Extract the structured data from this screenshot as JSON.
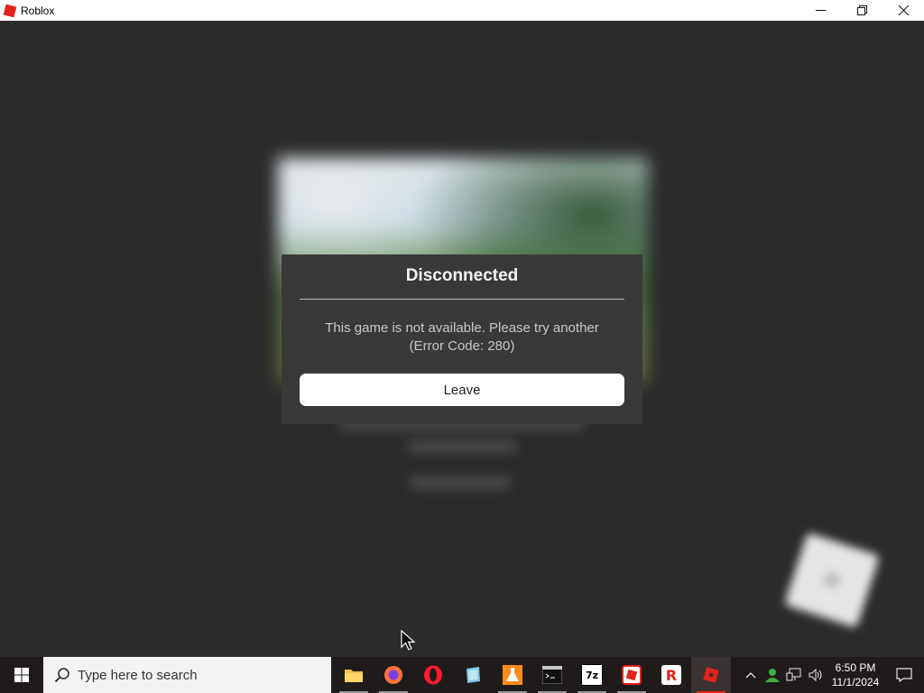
{
  "window": {
    "title": "Roblox",
    "controls": {
      "minimize_icon": "─",
      "restore_icon": "❐",
      "close_icon": "✕"
    }
  },
  "dialog": {
    "heading": "Disconnected",
    "message_line1": "This game is not available. Please try another",
    "message_line2": "(Error Code: 280)",
    "leave_label": "Leave"
  },
  "taskbar": {
    "search_placeholder": "Type here to search",
    "apps": [
      {
        "name": "file-explorer",
        "color": "#f2c14e"
      },
      {
        "name": "firefox",
        "color": "#ff7139"
      },
      {
        "name": "opera",
        "color": "#ff1b2d"
      },
      {
        "name": "notepad",
        "color": "#7fc6e8"
      },
      {
        "name": "lab-flask",
        "color": "#ff8c1a"
      },
      {
        "name": "terminal",
        "color": "#111111"
      },
      {
        "name": "7zip",
        "label": "7z",
        "color": "#ffffff"
      },
      {
        "name": "roblox-studio",
        "color": "#e2231a"
      },
      {
        "name": "roblox-player",
        "label": "R",
        "color": "#e2231a"
      },
      {
        "name": "roblox-active",
        "color": "#e2231a"
      }
    ],
    "clock": {
      "time": "6:50 PM",
      "date": "11/1/2024"
    }
  }
}
